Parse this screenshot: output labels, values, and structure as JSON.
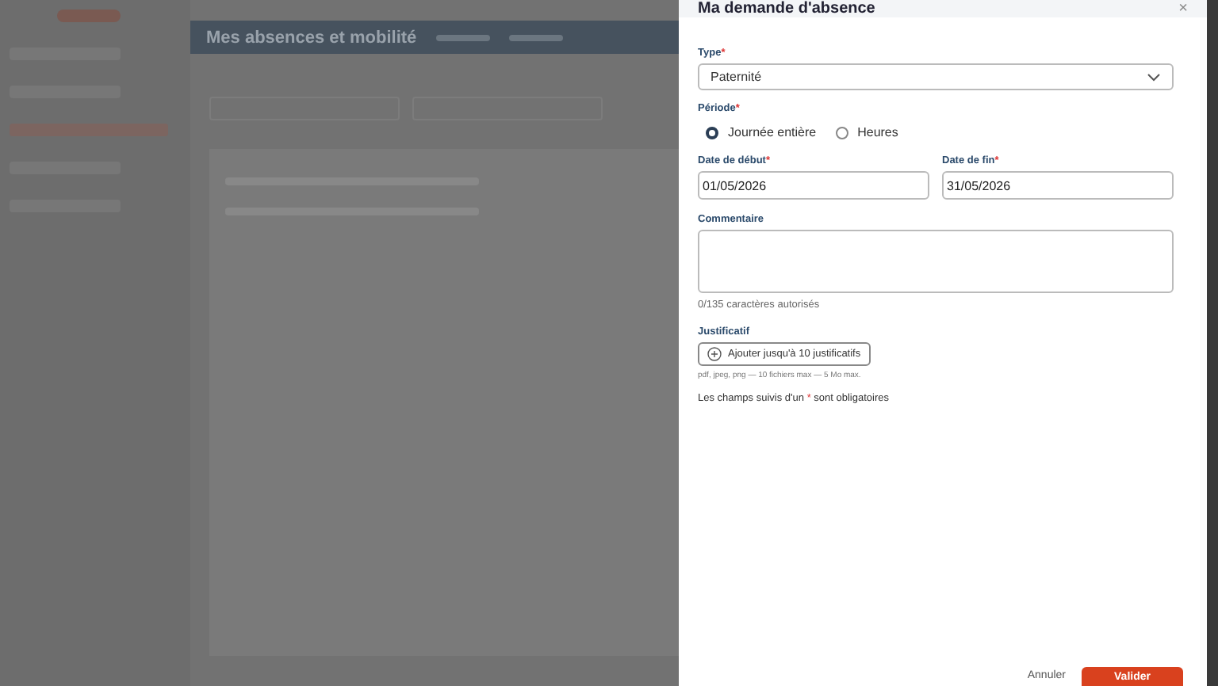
{
  "page": {
    "title": "Mes absences et mobilité"
  },
  "dialog": {
    "title": "Ma demande d'absence",
    "close": "×",
    "type": {
      "label": "Type",
      "required_mark": "*",
      "value": "Paternité"
    },
    "period": {
      "label": "Période",
      "required_mark": "*",
      "options": [
        {
          "label": "Journée entière",
          "selected": true
        },
        {
          "label": "Heures",
          "selected": false
        }
      ]
    },
    "dates": [
      {
        "label": "Date de début",
        "required_mark": "*",
        "value": "01/05/2026"
      },
      {
        "label": "Date de fin",
        "required_mark": "*",
        "value": "31/05/2026"
      }
    ],
    "comment": {
      "label": "Commentaire",
      "counter": "0/135 caractères autorisés"
    },
    "attachments": {
      "label": "Justificatif",
      "button": "Ajouter jusqu'à 10 justificatifs",
      "hint": "pdf, jpeg, png — 10 fichiers max — 5 Mo max."
    },
    "required_note": {
      "before": "Les champs suivis d'un",
      "mark": "*",
      "after": "sont obligatoires"
    },
    "buttons": [
      {
        "label": "Annuler",
        "kind": "secondary"
      },
      {
        "label": "Valider",
        "kind": "primary"
      }
    ]
  }
}
